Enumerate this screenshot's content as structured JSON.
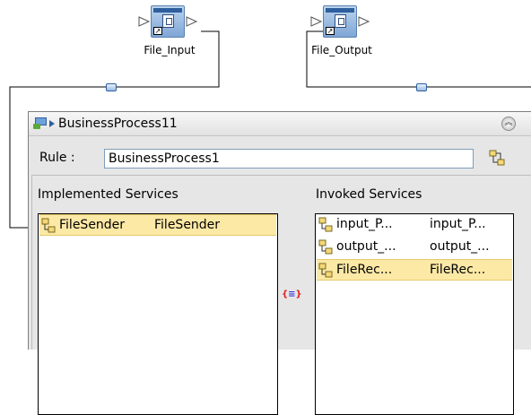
{
  "nodes": {
    "input": {
      "label": "File_Input",
      "link_glyph": "↗"
    },
    "output": {
      "label": "File_Output",
      "link_glyph": "↗"
    }
  },
  "process": {
    "name": "BusinessProcess11",
    "rule_label": "Rule :",
    "rule_value": "BusinessProcess1"
  },
  "services": {
    "implemented_heading": "Implemented Services",
    "invoked_heading": "Invoked Services",
    "implemented": [
      {
        "name": "FileSender",
        "operation": "FileSender",
        "selected": true
      }
    ],
    "invoked": [
      {
        "name": "input_P...",
        "operation": "input_P...",
        "selected": false
      },
      {
        "name": "output_...",
        "operation": "output_...",
        "selected": false
      },
      {
        "name": "FileRec...",
        "operation": "FileRec...",
        "selected": true
      }
    ],
    "mapping_glyph_left": "{",
    "mapping_glyph_mid": "≡",
    "mapping_glyph_right": "}"
  },
  "colors": {
    "selection": "#fde9a6",
    "panel": "#e6e6e6",
    "accent": "#2f5f9e"
  }
}
